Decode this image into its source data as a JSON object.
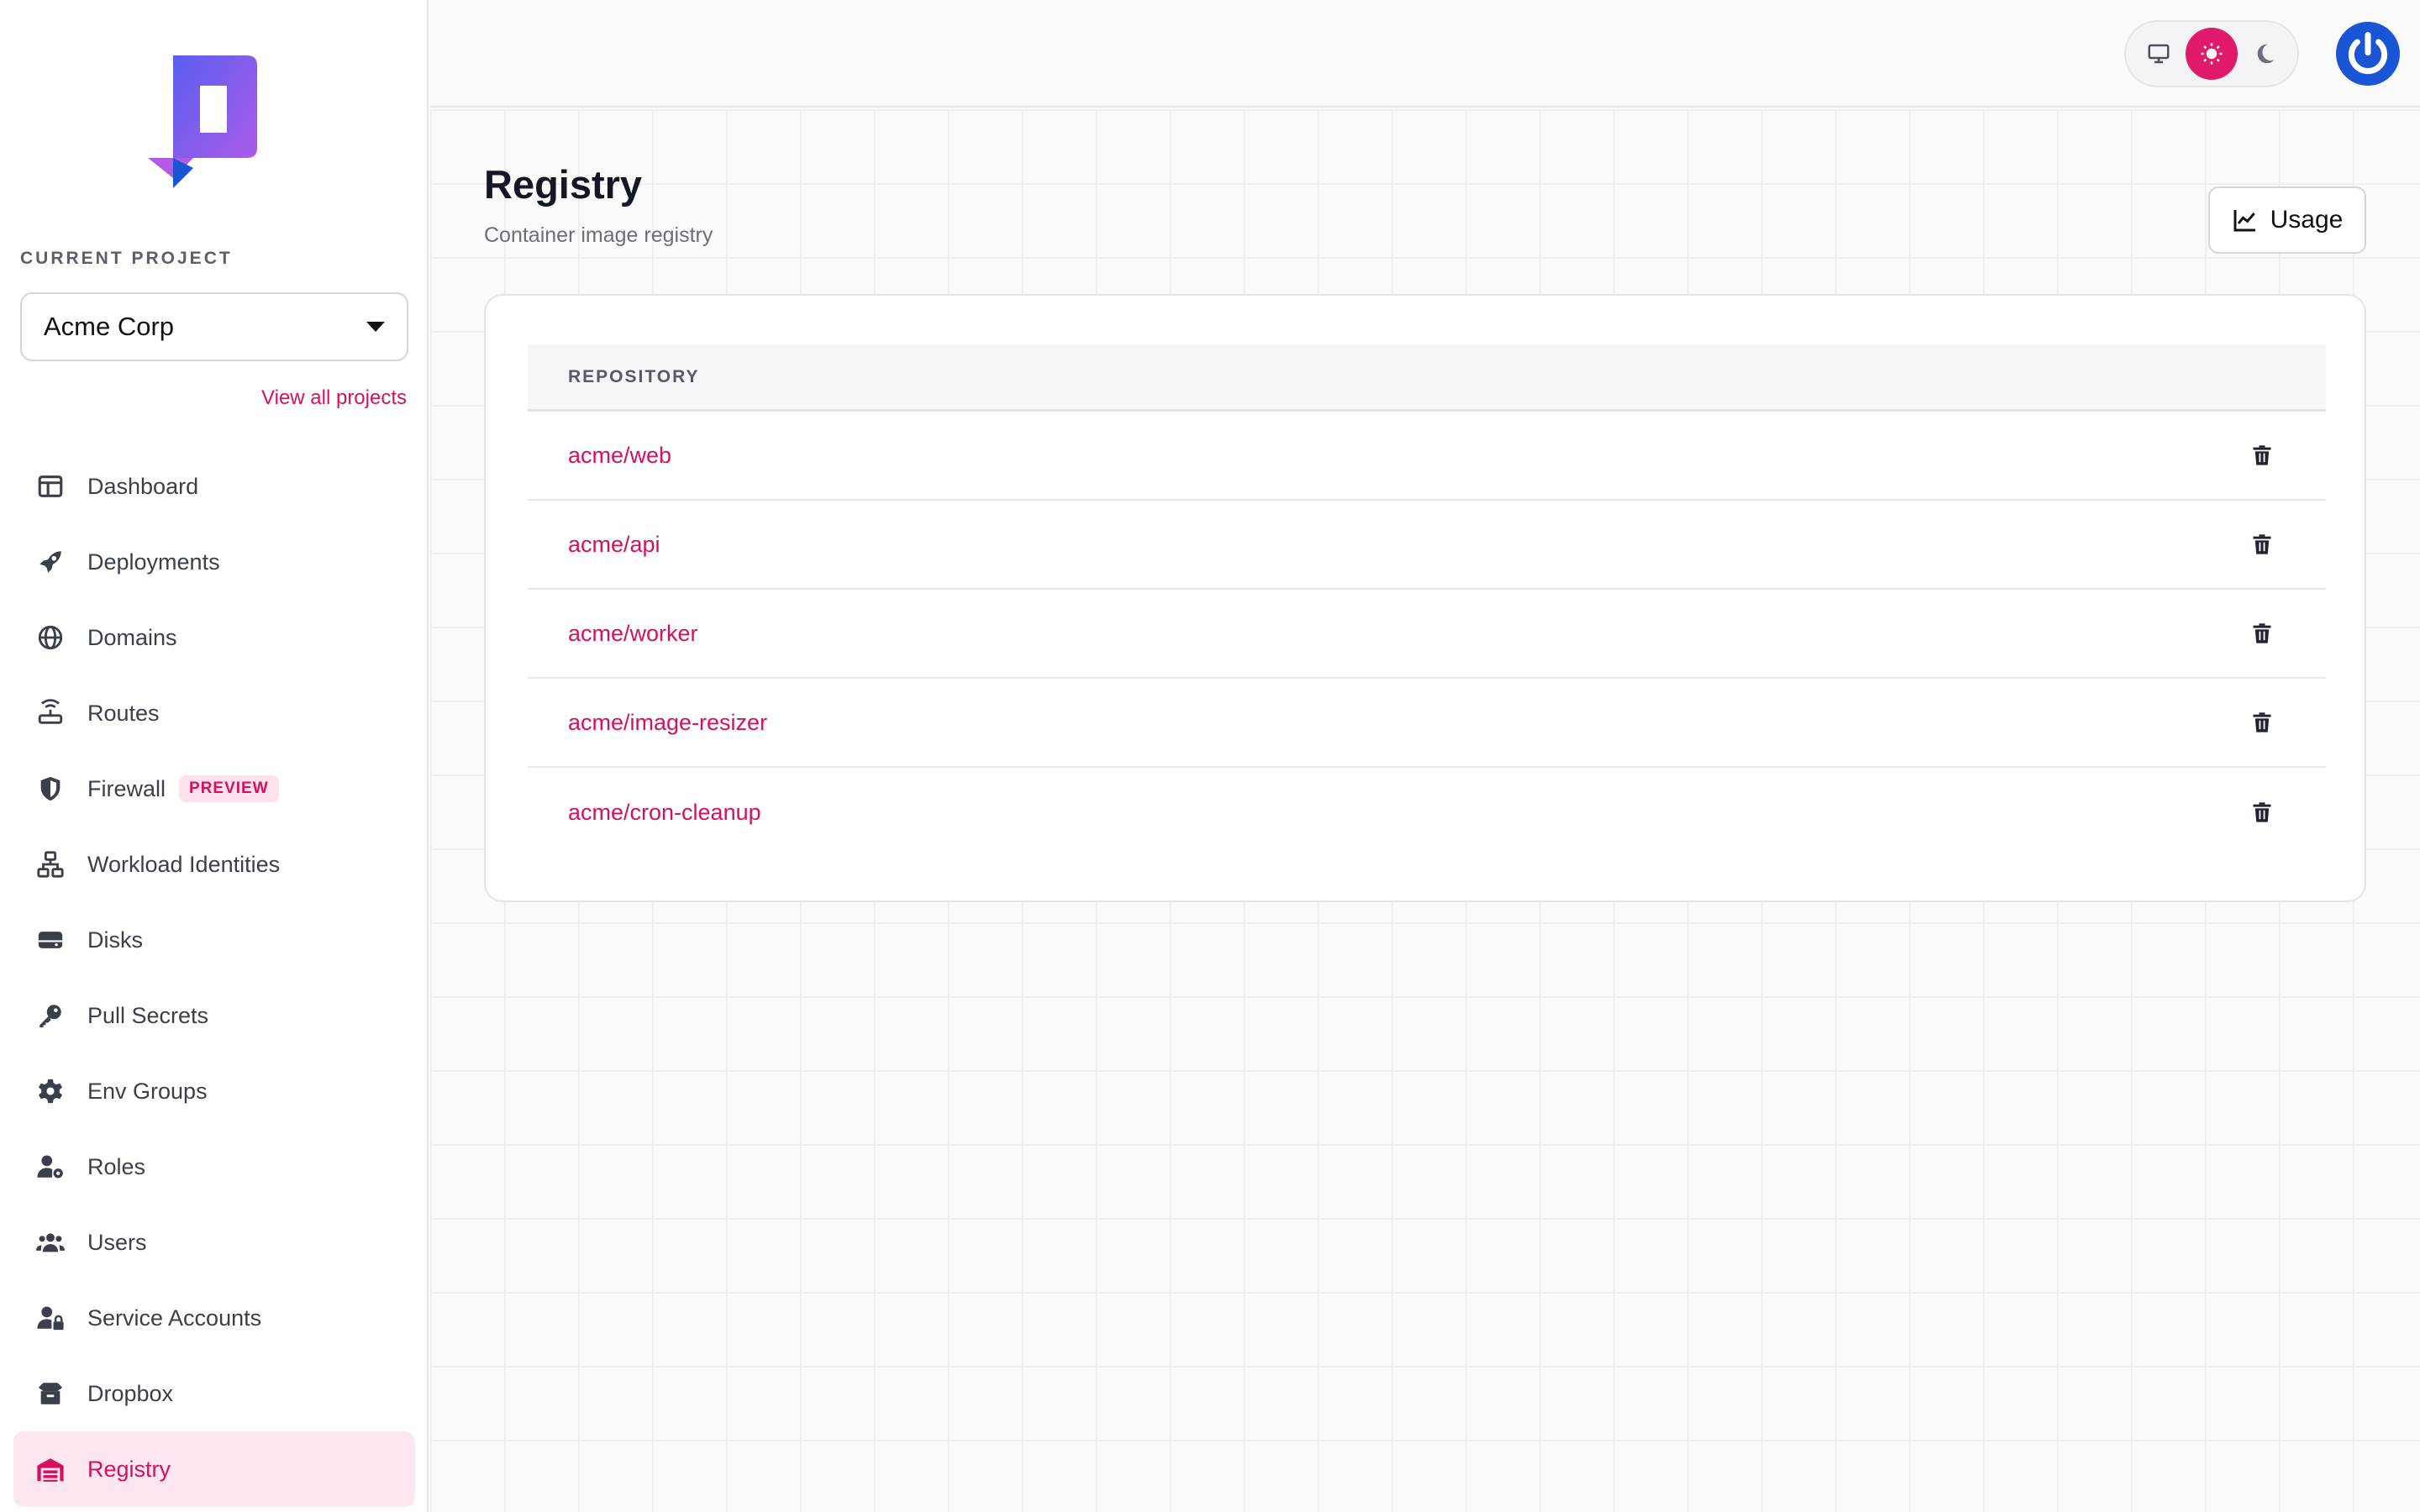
{
  "app": {
    "title": "Registry",
    "accent": "#d6105f"
  },
  "sidebar": {
    "project_label": "CURRENT PROJECT",
    "project_selected": "Acme Corp",
    "view_all": "View all projects",
    "items": [
      {
        "label": "Dashboard",
        "icon": "dashboard-icon"
      },
      {
        "label": "Deployments",
        "icon": "rocket-icon"
      },
      {
        "label": "Domains",
        "icon": "globe-icon"
      },
      {
        "label": "Routes",
        "icon": "router-icon"
      },
      {
        "label": "Firewall",
        "icon": "shield-icon",
        "badge": "PREVIEW"
      },
      {
        "label": "Workload Identities",
        "icon": "network-icon"
      },
      {
        "label": "Disks",
        "icon": "disk-icon"
      },
      {
        "label": "Pull Secrets",
        "icon": "key-icon"
      },
      {
        "label": "Env Groups",
        "icon": "gear-icon"
      },
      {
        "label": "Roles",
        "icon": "user-gear-icon"
      },
      {
        "label": "Users",
        "icon": "users-icon"
      },
      {
        "label": "Service Accounts",
        "icon": "user-lock-icon"
      },
      {
        "label": "Dropbox",
        "icon": "box-icon"
      },
      {
        "label": "Registry",
        "icon": "warehouse-icon",
        "active": true
      }
    ]
  },
  "topbar": {
    "theme_options": [
      "system",
      "light",
      "dark"
    ],
    "theme_selected": "light"
  },
  "main": {
    "title": "Registry",
    "subtitle": "Container image registry",
    "usage_label": "Usage",
    "table": {
      "header": "REPOSITORY",
      "rows": [
        "acme/web",
        "acme/api",
        "acme/worker",
        "acme/image-resizer",
        "acme/cron-cleanup"
      ]
    }
  }
}
